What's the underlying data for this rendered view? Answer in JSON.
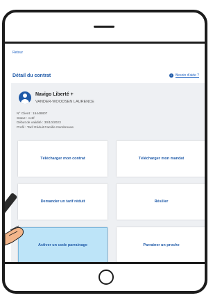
{
  "header": {
    "back_label": "Retour"
  },
  "page": {
    "title": "Détail du contrat",
    "help_label": "Besoin d'aide ?"
  },
  "contract": {
    "pass_name": "Navigo Liberté +",
    "holder_name": "VANDER-WOODSEN LAURENCE",
    "client_number": "N° Client : 15448807",
    "status": "Statut : Actif",
    "start_date": "Début de validité : 30/10/2023",
    "profile": "Profil : Tarif Réduit Famille Nombreuse"
  },
  "actions": {
    "download_contract": "Télécharger mon contrat",
    "download_mandate": "Télécharger mon mandat",
    "request_reduced": "Demander un tarif réduit",
    "cancel": "Résilier",
    "activate_sponsor_code": "Activer un code parrainage",
    "sponsor_relative": "Parrainer un proche"
  },
  "colors": {
    "accent": "#1f5aa8",
    "highlight_tile": "#bde4f8",
    "panel_bg": "#eef0f3",
    "device_frame": "#1c1c1c"
  }
}
